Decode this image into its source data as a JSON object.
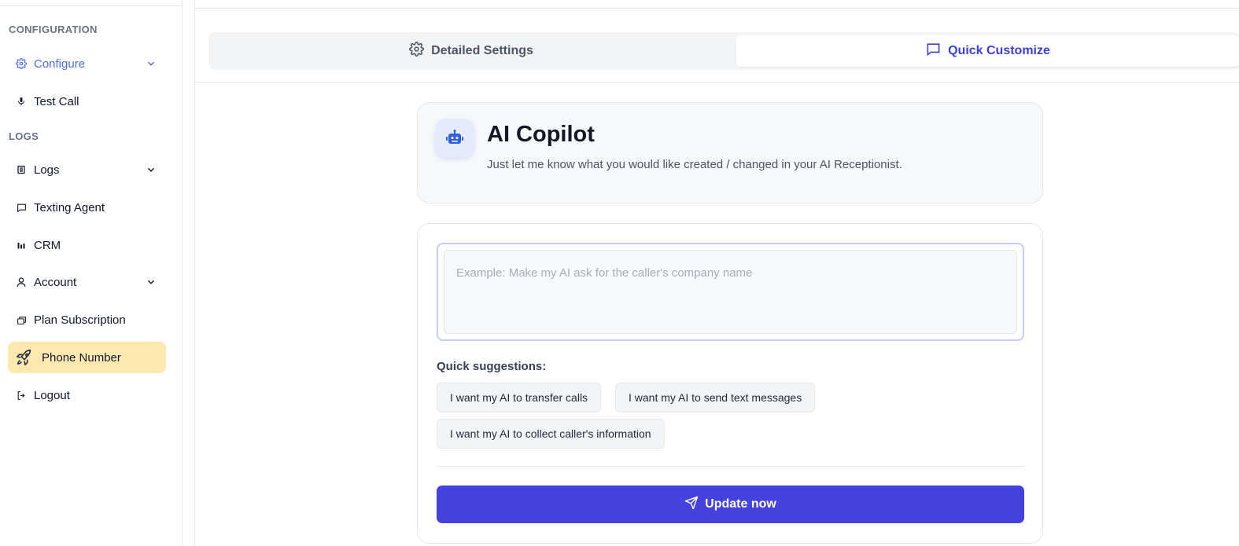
{
  "sidebar": {
    "sections": {
      "configuration": "CONFIGURATION",
      "logs": "LOGS"
    },
    "items": [
      {
        "label": "Configure",
        "icon": "gear-icon"
      },
      {
        "label": "Test Call",
        "icon": "microphone-icon"
      },
      {
        "label": "Logs",
        "icon": "document-list-icon"
      },
      {
        "label": "Texting Agent",
        "icon": "chat-icon"
      },
      {
        "label": "CRM",
        "icon": "bar-chart-icon"
      },
      {
        "label": "Account",
        "icon": "user-icon"
      },
      {
        "label": "Plan Subscription",
        "icon": "layers-icon"
      },
      {
        "label": "Phone Number",
        "icon": "rocket-icon"
      },
      {
        "label": "Logout",
        "icon": "logout-icon"
      }
    ]
  },
  "tabs": [
    {
      "label": "Detailed Settings",
      "icon": "gear-icon"
    },
    {
      "label": "Quick Customize",
      "icon": "chat-icon"
    }
  ],
  "copilot": {
    "title": "AI Copilot",
    "subtitle": "Just let me know what you would like created / changed in your AI Receptionist.",
    "icon": "robot-icon"
  },
  "form": {
    "placeholder": "Example: Make my AI ask for the caller's company name",
    "value": "",
    "suggestions_label": "Quick suggestions:",
    "suggestions": [
      "I want my AI to transfer calls",
      "I want my AI to send text messages",
      "I want my AI to collect caller's information"
    ],
    "submit_label": "Update now",
    "submit_icon": "send-icon"
  },
  "colors": {
    "accent": "#4342dc",
    "active_nav": "#4f6bf0",
    "highlight": "#fde9b0"
  }
}
